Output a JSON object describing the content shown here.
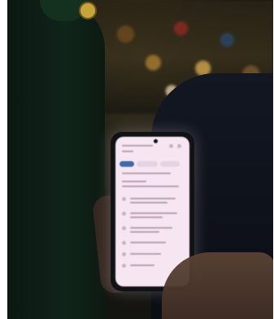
{
  "scene": {
    "description_colors": {
      "background": "#0c0d0b",
      "screen_glow": "#f6e6f1",
      "accent_chip": "#3d6aa8"
    },
    "icons": [
      "smartphone-icon"
    ]
  }
}
